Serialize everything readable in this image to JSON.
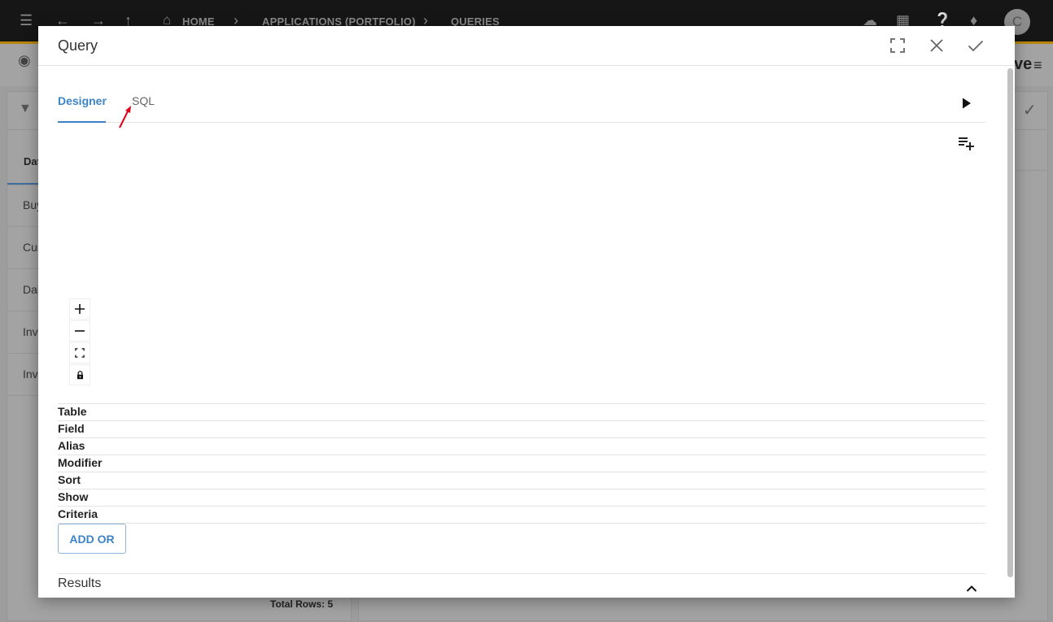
{
  "background_app": {
    "breadcrumb": [
      "HOME",
      "APPLICATIONS (PORTFOLIO)",
      "QUERIES"
    ],
    "avatar_initial": "C",
    "panel_tab": "Dat",
    "rows": [
      "Buy",
      "Cur",
      "Dai",
      "Inv",
      "Inv"
    ],
    "total_rows": "Total Rows: 5",
    "right_clip_text": "ve"
  },
  "modal": {
    "title": "Query",
    "tabs": [
      {
        "label": "Designer",
        "active": true
      },
      {
        "label": "SQL",
        "active": false
      }
    ],
    "grid_rows": [
      "Table",
      "Field",
      "Alias",
      "Modifier",
      "Sort",
      "Show",
      "Criteria"
    ],
    "add_or_label": "ADD OR",
    "results_label": "Results"
  },
  "colors": {
    "accent": "#3d84c6",
    "appbar": "#161616",
    "appbar_border": "#b8860b",
    "annotation": "#e0001a"
  },
  "icons": {
    "fullscreen": "fullscreen-icon",
    "close": "close-icon",
    "confirm": "check-icon",
    "run": "play-icon",
    "add_table": "playlist-add-icon",
    "zoom_in": "plus-icon",
    "zoom_out": "minus-icon",
    "fit": "fit-screen-icon",
    "lock": "lock-icon",
    "results_toggle": "chevron-up-icon"
  }
}
